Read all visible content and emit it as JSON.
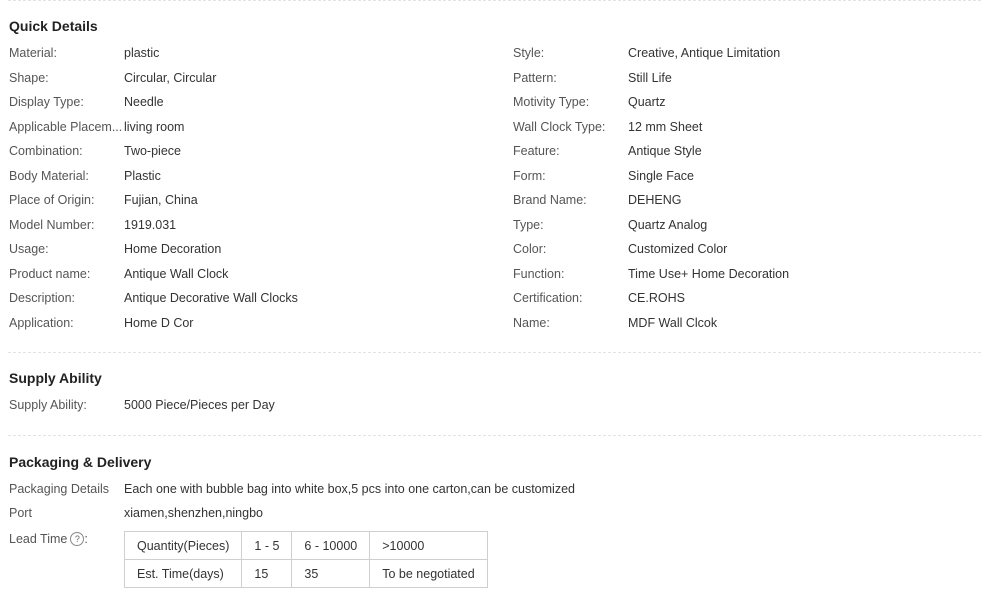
{
  "quick_details": {
    "title": "Quick Details",
    "left": [
      {
        "label": "Material:",
        "value": "plastic"
      },
      {
        "label": "Shape:",
        "value": "Circular, Circular"
      },
      {
        "label": "Display Type:",
        "value": "Needle"
      },
      {
        "label": "Applicable Placem...",
        "value": "living room"
      },
      {
        "label": "Combination:",
        "value": "Two-piece"
      },
      {
        "label": "Body Material:",
        "value": "Plastic"
      },
      {
        "label": "Place of Origin:",
        "value": "Fujian, China"
      },
      {
        "label": "Model Number:",
        "value": "1919.031"
      },
      {
        "label": "Usage:",
        "value": "Home Decoration"
      },
      {
        "label": "Product name:",
        "value": "Antique Wall Clock"
      },
      {
        "label": "Description:",
        "value": "Antique Decorative Wall Clocks"
      },
      {
        "label": "Application:",
        "value": "Home D Cor"
      }
    ],
    "right": [
      {
        "label": "Style:",
        "value": "Creative, Antique Limitation"
      },
      {
        "label": "Pattern:",
        "value": "Still Life"
      },
      {
        "label": "Motivity Type:",
        "value": "Quartz"
      },
      {
        "label": "Wall Clock Type:",
        "value": "12 mm Sheet"
      },
      {
        "label": "Feature:",
        "value": "Antique Style"
      },
      {
        "label": "Form:",
        "value": "Single Face"
      },
      {
        "label": "Brand Name:",
        "value": "DEHENG"
      },
      {
        "label": "Type:",
        "value": "Quartz Analog"
      },
      {
        "label": "Color:",
        "value": "Customized Color"
      },
      {
        "label": "Function:",
        "value": "Time Use+ Home Decoration"
      },
      {
        "label": "Certification:",
        "value": "CE.ROHS"
      },
      {
        "label": "Name:",
        "value": "MDF Wall Clcok"
      }
    ]
  },
  "supply": {
    "title": "Supply Ability",
    "label": "Supply Ability:",
    "value": "5000 Piece/Pieces per Day"
  },
  "packaging": {
    "title": "Packaging & Delivery",
    "details_label": "Packaging Details",
    "details_value": "Each one with bubble bag into white box,5 pcs into one carton,can be customized",
    "port_label": "Port",
    "port_value": "xiamen,shenzhen,ningbo",
    "lead_label": "Lead Time",
    "lead_help": "?",
    "lead_colon": ":",
    "lead_table": [
      [
        "Quantity(Pieces)",
        "1 - 5",
        "6 - 10000",
        ">10000"
      ],
      [
        "Est. Time(days)",
        "15",
        "35",
        "To be negotiated"
      ]
    ]
  }
}
